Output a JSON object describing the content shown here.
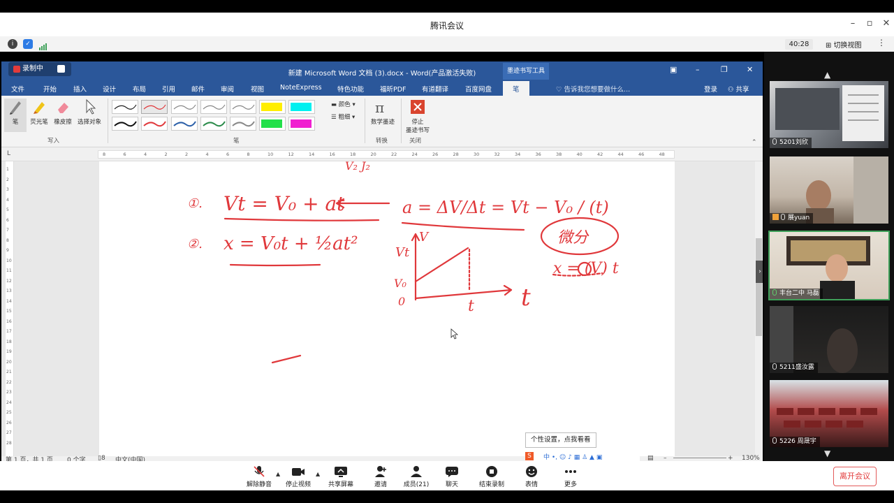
{
  "meeting": {
    "title": "腾讯会议",
    "timer": "40:28",
    "switch_view": "切换视图",
    "leave": "离开会议",
    "tooltip": "个性设置，点我看看"
  },
  "word": {
    "recording": "录制中",
    "doc_title": "新建 Microsoft Word 文档 (3).docx - Word(产品激活失败)",
    "ink_tools": "墨迹书写工具",
    "tabs": [
      "文件",
      "开始",
      "插入",
      "设计",
      "布局",
      "引用",
      "邮件",
      "审阅",
      "视图",
      "NoteExpress",
      "特色功能",
      "福昕PDF",
      "有道翻译",
      "百度网盘",
      "笔"
    ],
    "tell_me": "告诉我您想要做什么...",
    "login": "登录",
    "share": "共享",
    "ribbon": {
      "pen": "笔",
      "highlighter": "荧光笔",
      "eraser": "橡皮擦",
      "select": "选择对象",
      "color": "颜色",
      "thickness": "粗细",
      "math": "数学墨迹",
      "stop_line1": "停止",
      "stop_line2": "墨迹书写",
      "grp_write": "写入",
      "grp_pen": "笔",
      "grp_convert": "转换",
      "grp_close": "关闭"
    },
    "ruler": [
      "8",
      "6",
      "4",
      "2",
      "2",
      "4",
      "6",
      "8",
      "10",
      "12",
      "14",
      "16",
      "18",
      "20",
      "22",
      "24",
      "26",
      "28",
      "30",
      "32",
      "34",
      "36",
      "38",
      "40",
      "42",
      "44",
      "46",
      "48"
    ],
    "vruler": [
      "1",
      "2",
      "3",
      "4",
      "5",
      "6",
      "7",
      "8",
      "9",
      "10",
      "11",
      "12",
      "13",
      "14",
      "15",
      "16",
      "17",
      "18",
      "19",
      "20",
      "21",
      "22",
      "23",
      "24",
      "25",
      "26",
      "27",
      "28"
    ],
    "status": {
      "page": "第 1 页，共 1 页",
      "words": "0 个字",
      "lang": "中文(中国)",
      "zoom": "130%"
    },
    "ink_text": {
      "eq1_num": "①.",
      "eq1": "Vt = V₀ + at",
      "eq1_rhs": "a = ΔV/Δt = Vt − V₀ / (t)",
      "eq2_num": "②.",
      "eq2": "x = V₀t + ½at²",
      "graph_v": "V",
      "graph_vt": "Vt",
      "graph_v0": "V₀",
      "graph_o": "0",
      "graph_t": "t",
      "graph_t_axis": "t",
      "bubble": "微分",
      "bubble_eq": "x = (V) t",
      "top_frag": "V₂   J₂"
    }
  },
  "participants": [
    {
      "name": "5201刘欣"
    },
    {
      "name": "展yuan"
    },
    {
      "name": "丰台二中 马磊"
    },
    {
      "name": "5211盛汝露"
    },
    {
      "name": "5226 周晟宇"
    }
  ],
  "toolbar": [
    {
      "label": "解除静音",
      "icon": "mic-muted-icon"
    },
    {
      "label": "停止视频",
      "icon": "camera-icon"
    },
    {
      "label": "共享屏幕",
      "icon": "share-screen-icon"
    },
    {
      "label": "邀请",
      "icon": "invite-icon"
    },
    {
      "label": "成员(21)",
      "icon": "members-icon"
    },
    {
      "label": "聊天",
      "icon": "chat-icon"
    },
    {
      "label": "结束录制",
      "icon": "stop-record-icon"
    },
    {
      "label": "表情",
      "icon": "emoji-icon"
    },
    {
      "label": "更多",
      "icon": "more-icon"
    }
  ],
  "colors": {
    "word_blue": "#2b579a",
    "ink_red": "#e0383b",
    "active_green": "#3fa15a"
  }
}
